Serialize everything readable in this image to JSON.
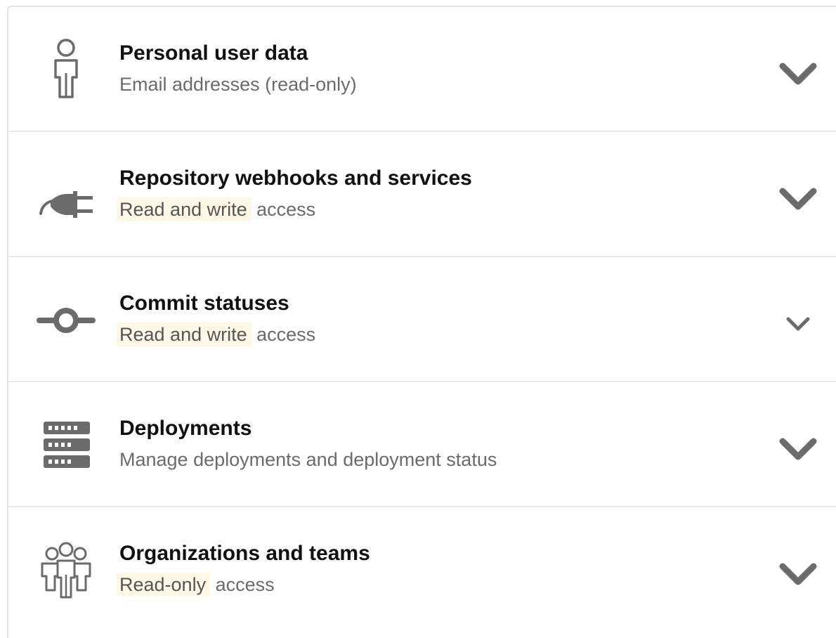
{
  "permissions": [
    {
      "icon": "person-icon",
      "title": "Personal user data",
      "desc_highlight": "",
      "desc_rest": "Email addresses (read-only)"
    },
    {
      "icon": "plug-icon",
      "title": "Repository webhooks and services",
      "desc_highlight": "Read and write",
      "desc_rest": " access"
    },
    {
      "icon": "commit-icon",
      "title": "Commit statuses",
      "desc_highlight": "Read and write",
      "desc_rest": " access"
    },
    {
      "icon": "server-icon",
      "title": "Deployments",
      "desc_highlight": "",
      "desc_rest": "Manage deployments and deployment status"
    },
    {
      "icon": "organization-icon",
      "title": "Organizations and teams",
      "desc_highlight": "Read-only",
      "desc_rest": " access"
    }
  ],
  "colors": {
    "icon": "#6b6b6b",
    "highlight_bg": "#fff8e6",
    "title": "#111111",
    "description": "#6b6b6b",
    "divider": "#e8e8e8"
  }
}
